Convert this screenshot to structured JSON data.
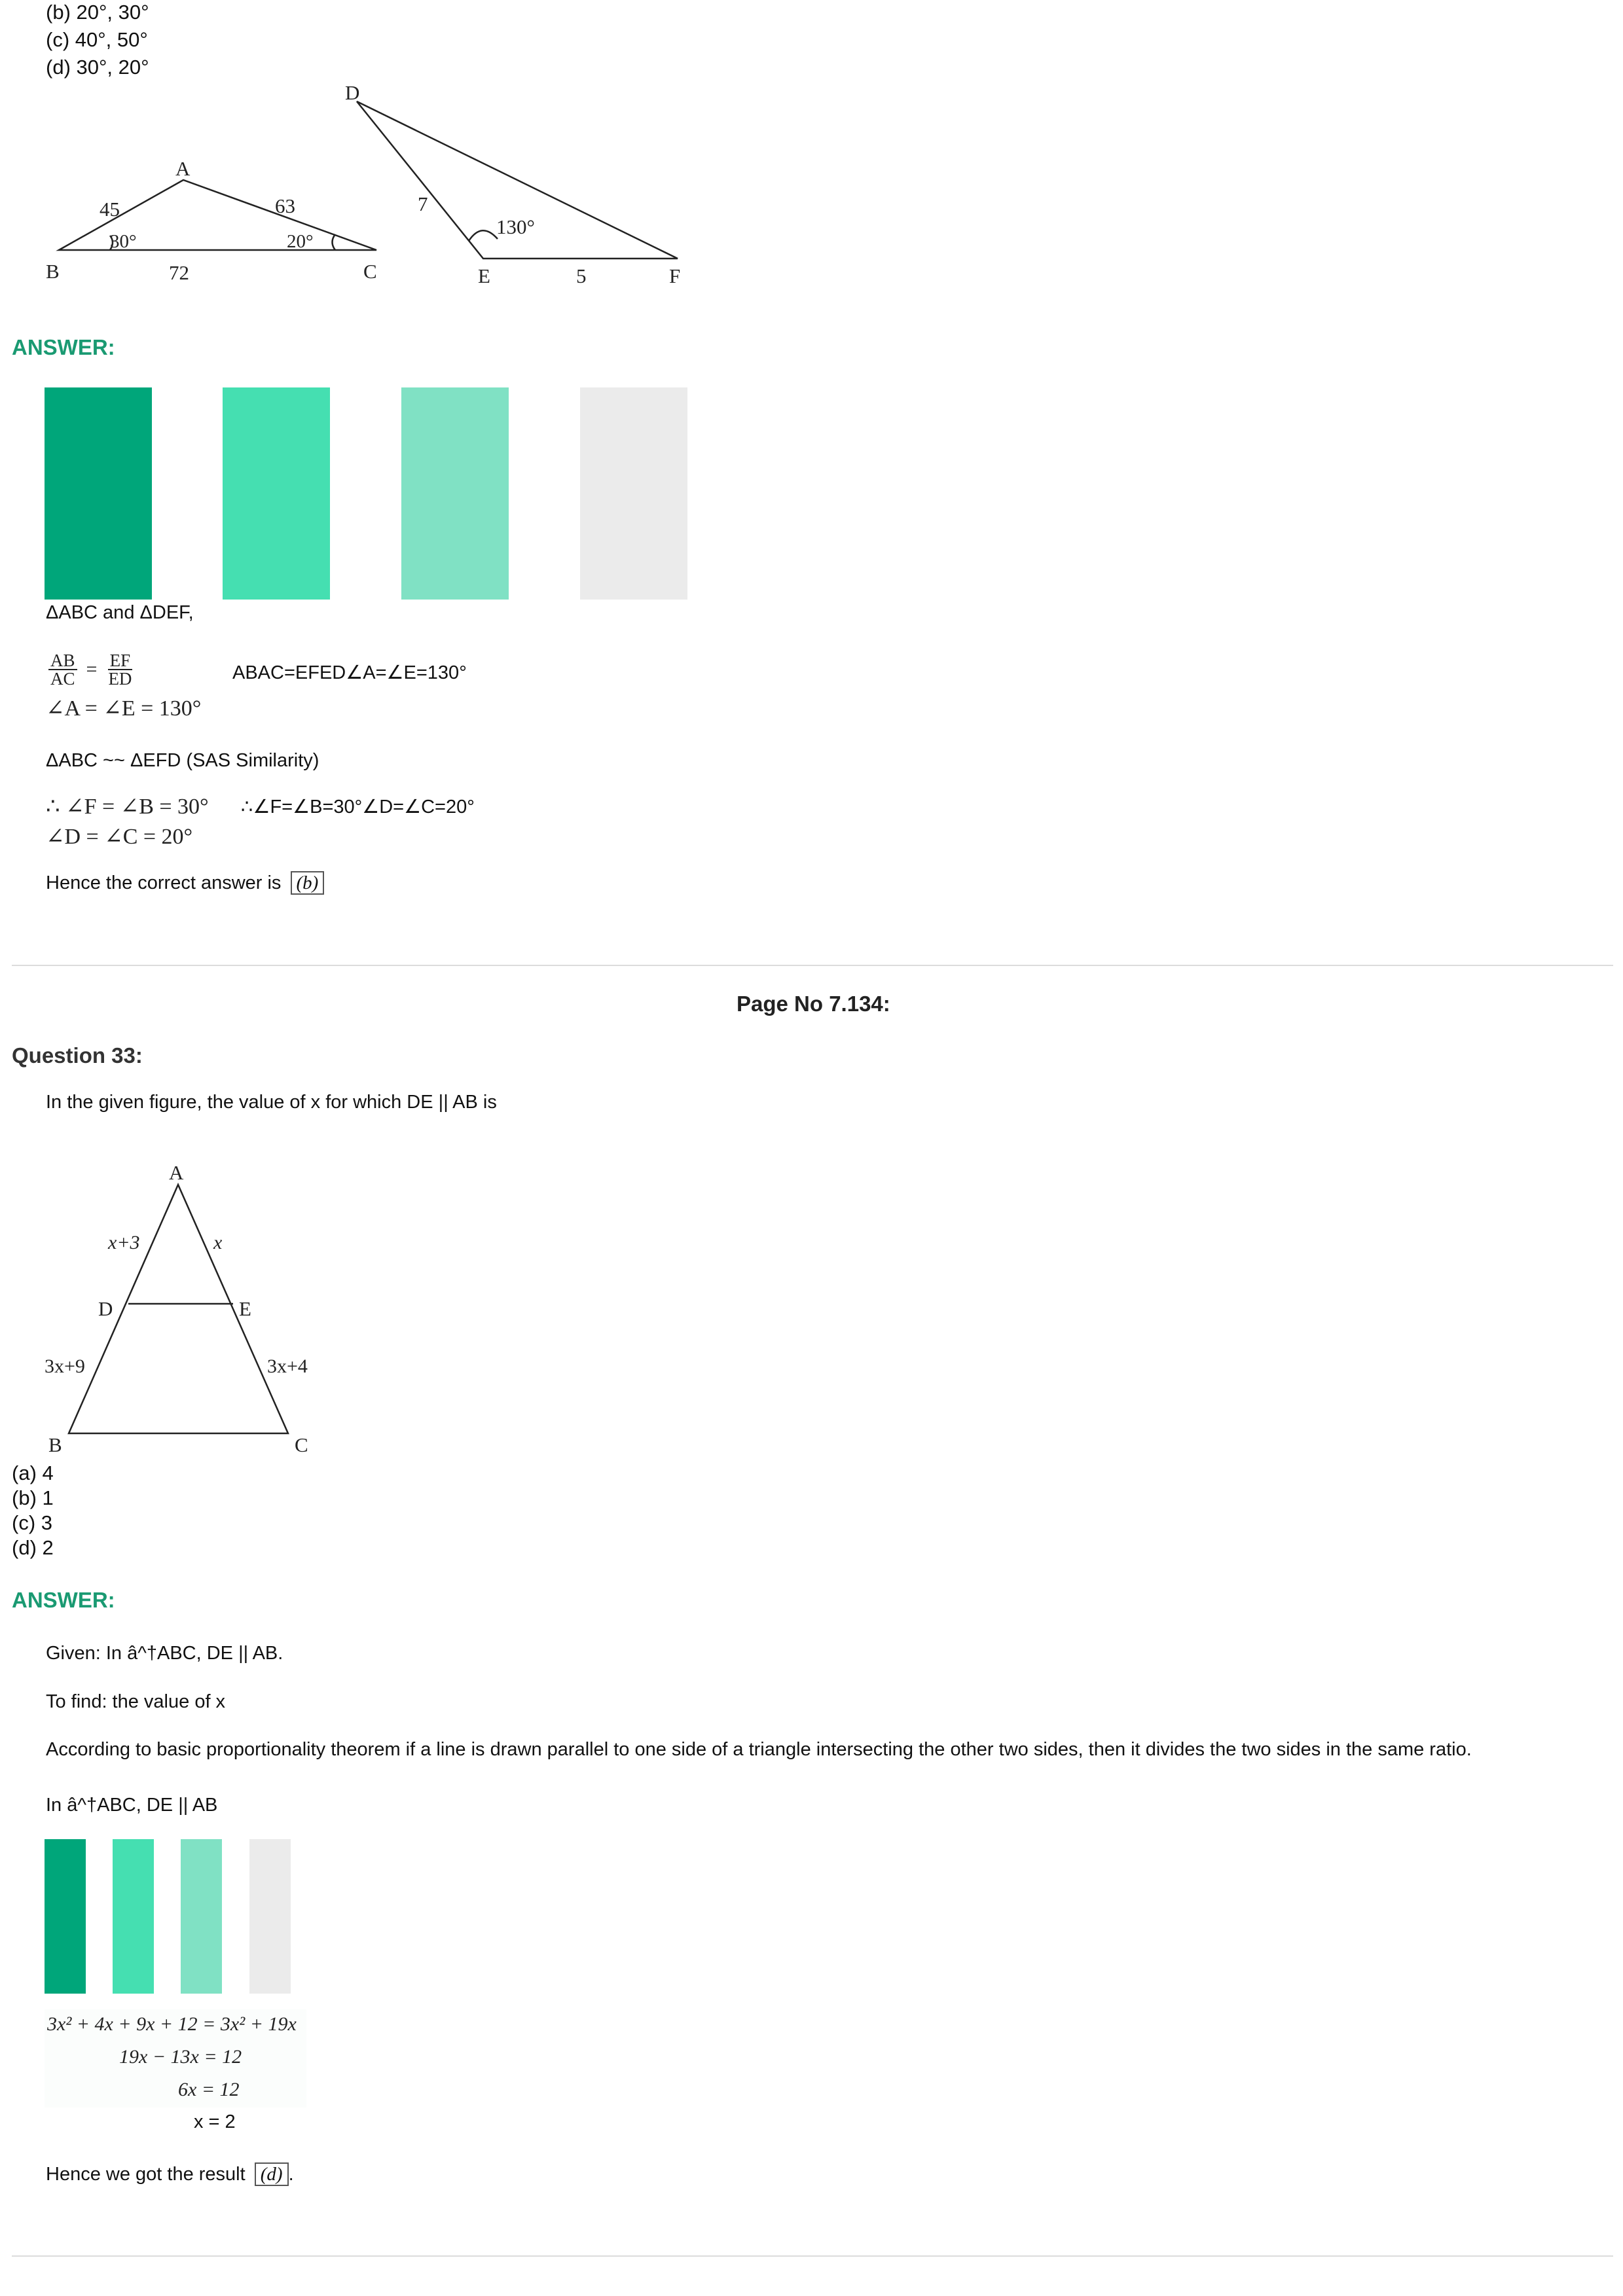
{
  "top_options": [
    "(b) 20°, 30°",
    "(c) 40°, 50°",
    "(d) 30°, 20°"
  ],
  "fig1": {
    "labels": {
      "A": "A",
      "B": "B",
      "C": "C",
      "D": "D",
      "E": "E",
      "F": "F",
      "ab": "45",
      "ac": "63",
      "bc": "72",
      "angle_b": "30°",
      "angle_c": "20°",
      "de": "7",
      "ef": "5",
      "angle_e": "130°"
    }
  },
  "answer1": {
    "heading": "ANSWER:",
    "bar_colors": [
      "#00a67a",
      "#45dfb1",
      "#80e1c4",
      "#ebebeb"
    ],
    "line1": "ΔABC and ΔDEF,",
    "frac_ab": "AB",
    "frac_ac": "AC",
    "equals": "=",
    "frac_ef": "EF",
    "frac_ed": "ED",
    "alt1": "ABAC=EFED∠A=∠E=130°",
    "angle_line": "∠A = ∠E = 130°",
    "similar": "ΔABC ~~ ΔEFD   (SAS Similarity)",
    "therefore1": "∴ ∠F = ∠B = 30°",
    "alt2": "∴∠F=∠B=30°∠D=∠C=20°",
    "therefore2": "∠D = ∠C = 20°",
    "conclusion": "Hence the correct answer is",
    "answer_letter": "(b)"
  },
  "page_no": "Page No 7.134:",
  "question33": {
    "heading": "Question 33:",
    "text": "In the given figure, the value of x for which DE || AB is",
    "fig_labels": {
      "A": "A",
      "B": "B",
      "C": "C",
      "D": "D",
      "E": "E",
      "ad": "x+3",
      "ae": "x",
      "db": "3x+9",
      "ec": "3x+4"
    },
    "options": [
      "(a) 4",
      "(b) 1",
      "(c) 3",
      "(d) 2"
    ]
  },
  "answer2": {
    "heading": "ANSWER:",
    "given": "Given: In â^†ABC,  DE || AB.",
    "to_find": "To find: the value of x",
    "theorem": "According to basic proportionality theorem if a line is drawn parallel to one side of a triangle intersecting the other two sides, then it divides the two sides in the same ratio.",
    "in_abc": "In â^†ABC,  DE || AB",
    "bar_colors": [
      "#00a67a",
      "#45dfb1",
      "#80e1c4",
      "#ebebeb"
    ],
    "eq1": "3x² + 4x + 9x + 12 = 3x² + 19x",
    "eq2": "19x − 13x = 12",
    "eq3": "6x = 12",
    "eq4": "x = 2",
    "conclusion": "Hence we got the result",
    "answer_letter": "(d)",
    "period": "."
  }
}
